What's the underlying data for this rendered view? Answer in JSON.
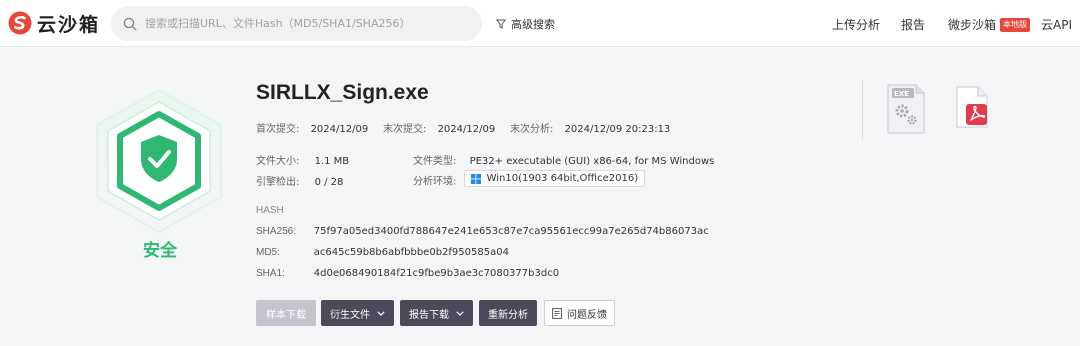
{
  "header": {
    "logo_text": "云沙箱",
    "search_placeholder": "搜索或扫描URL、文件Hash（MD5/SHA1/SHA256）",
    "advanced_search": "高级搜索",
    "nav": {
      "upload": "上传分析",
      "report": "报告",
      "wbsb": "微步沙箱",
      "wbsb_badge": "本地版",
      "api": "云API"
    }
  },
  "verdict": {
    "label": "安全",
    "color": "#2eb872"
  },
  "file": {
    "name": "SIRLLX_Sign.exe",
    "first_submit_label": "首次提交:",
    "first_submit": "2024/12/09",
    "last_submit_label": "末次提交:",
    "last_submit": "2024/12/09",
    "last_analysis_label": "末次分析:",
    "last_analysis": "2024/12/09 20:23:13",
    "size_label": "文件大小:",
    "size": "1.1 MB",
    "type_label": "文件类型:",
    "type": "PE32+ executable (GUI) x86-64, for MS Windows",
    "engine_label": "引擎检出:",
    "engine": "0 / 28",
    "env_label": "分析环境:",
    "env": "Win10(1903 64bit,Office2016)"
  },
  "hash": {
    "heading": "HASH",
    "sha256_label": "SHA256:",
    "sha256": "75f97a05ed3400fd788647e241e653c87e7ca95561ecc99a7e265d74b86073ac",
    "md5_label": "MD5:",
    "md5": "ac645c59b8b6abfbbbe0b2f950585a04",
    "sha1_label": "SHA1:",
    "sha1": "4d0e068490184f21c9fbe9b3ae3c7080377b3dc0"
  },
  "actions": {
    "sample_download": "样本下载",
    "derived_files": "衍生文件",
    "report_download": "报告下载",
    "reanalyze": "重新分析",
    "feedback": "问题反馈"
  },
  "right_icons": {
    "exe_tag": "EXE",
    "exe_icon": "exe-file-icon",
    "pdf_icon": "pdf-file-icon"
  },
  "colors": {
    "accent_green": "#2eb872",
    "brand_red": "#e8463a",
    "button_dark": "#4a4a5a"
  }
}
